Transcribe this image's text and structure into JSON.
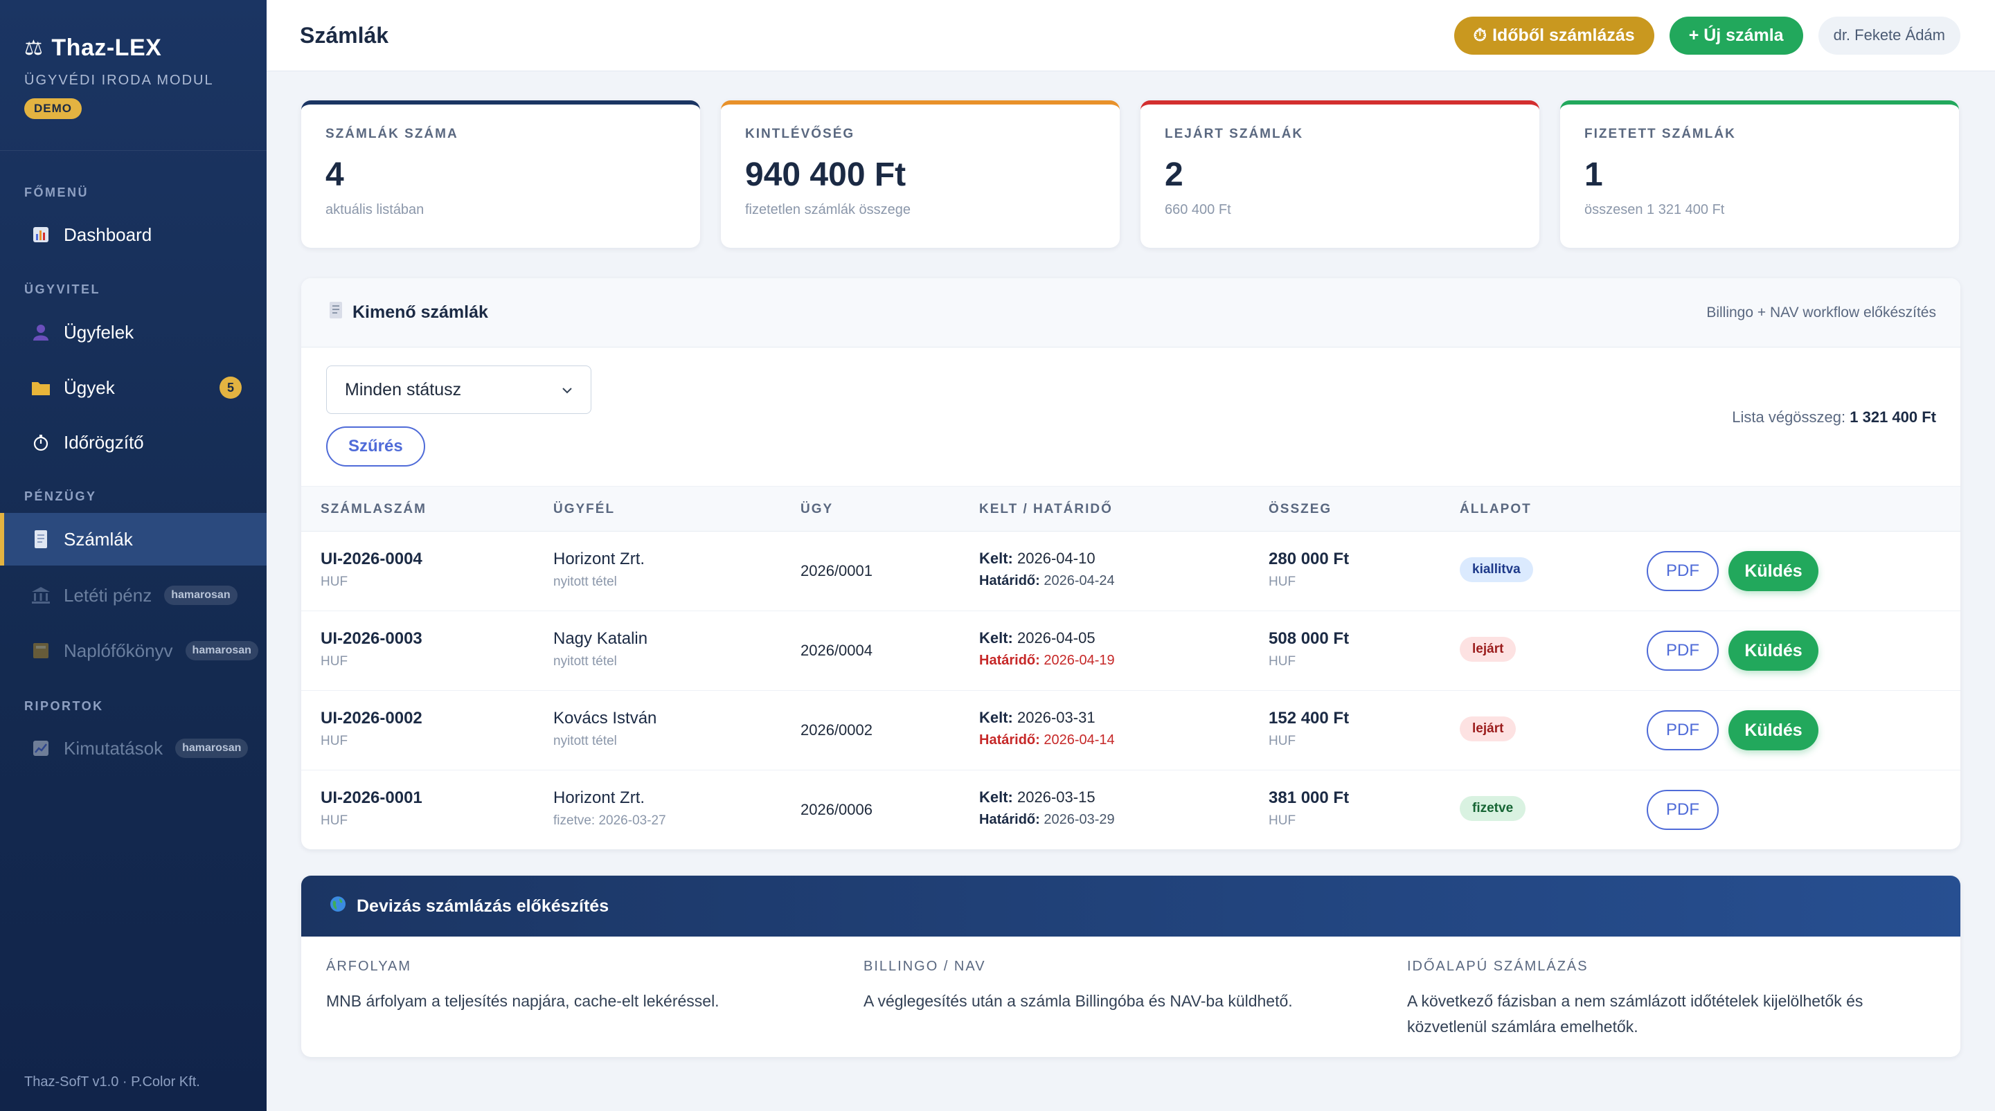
{
  "app": {
    "name": "Thaz-LEX",
    "subtitle": "ÜGYVÉDI IRODA MODUL",
    "badge": "DEMO",
    "footer": "Thaz-SofT v1.0 · P.Color Kft."
  },
  "sidebar": {
    "sections": [
      "FŐMENÜ",
      "ÜGYVITEL",
      "PÉNZÜGY",
      "RIPORTOK"
    ],
    "items": [
      {
        "label": "Dashboard",
        "icon": "bar-chart-icon"
      },
      {
        "label": "Ügyfelek",
        "icon": "person-icon"
      },
      {
        "label": "Ügyek",
        "icon": "folder-icon",
        "count": "5"
      },
      {
        "label": "Időrögzítő",
        "icon": "stopwatch-icon"
      },
      {
        "label": "Számlák",
        "icon": "invoice-icon",
        "active": true
      },
      {
        "label": "Letéti pénz",
        "icon": "bank-icon",
        "tag": "hamarosan"
      },
      {
        "label": "Naplófőkönyv",
        "icon": "ledger-icon",
        "tag": "hamarosan"
      },
      {
        "label": "Kimutatások",
        "icon": "chart-icon",
        "tag": "hamarosan"
      }
    ]
  },
  "header": {
    "title": "Számlák",
    "time_billing_label": "Időből számlázás",
    "new_invoice_label": "+ Új számla",
    "user": "dr. Fekete Ádám"
  },
  "stats": [
    {
      "label": "SZÁMLÁK SZÁMA",
      "value": "4",
      "sub": "aktuális listában",
      "color": "#1b3563"
    },
    {
      "label": "KINTLÉVŐSÉG",
      "value": "940 400 Ft",
      "sub": "fizetetlen számlák összege",
      "color": "#e8912a"
    },
    {
      "label": "LEJÁRT SZÁMLÁK",
      "value": "2",
      "sub": "660 400 Ft",
      "color": "#d32f2f"
    },
    {
      "label": "FIZETETT SZÁMLÁK",
      "value": "1",
      "sub": "összesen 1 321 400 Ft",
      "color": "#22a85c"
    }
  ],
  "invoices_panel": {
    "title": "Kimenő számlák",
    "note": "Billingo + NAV workflow előkészítés",
    "filter_value": "Minden státusz",
    "filter_button": "Szűrés",
    "total_label": "Lista végösszeg:",
    "total_value": "1 321 400 Ft",
    "columns": [
      "SZÁMLASZÁM",
      "ÜGYFÉL",
      "ÜGY",
      "KELT / HATÁRIDŐ",
      "ÖSSZEG",
      "ÁLLAPOT"
    ],
    "issued_label": "Kelt:",
    "due_label": "Határidő:",
    "pdf_label": "PDF",
    "send_label": "Küldés",
    "rows": [
      {
        "number": "UI-2026-0004",
        "currency": "HUF",
        "client": "Horizont Zrt.",
        "client_note": "nyitott tétel",
        "case": "2026/0001",
        "issued": "2026-04-10",
        "due": "2026-04-24",
        "amount": "280 000 Ft",
        "amount_currency": "HUF",
        "status": "kiallitva"
      },
      {
        "number": "UI-2026-0003",
        "currency": "HUF",
        "client": "Nagy Katalin",
        "client_note": "nyitott tétel",
        "case": "2026/0004",
        "issued": "2026-04-05",
        "due": "2026-04-19",
        "amount": "508 000 Ft",
        "amount_currency": "HUF",
        "status": "lejárt"
      },
      {
        "number": "UI-2026-0002",
        "currency": "HUF",
        "client": "Kovács István",
        "client_note": "nyitott tétel",
        "case": "2026/0002",
        "issued": "2026-03-31",
        "due": "2026-04-14",
        "amount": "152 400 Ft",
        "amount_currency": "HUF",
        "status": "lejárt"
      },
      {
        "number": "UI-2026-0001",
        "currency": "HUF",
        "client": "Horizont Zrt.",
        "client_note": "fizetve: 2026-03-27",
        "case": "2026/0006",
        "issued": "2026-03-15",
        "due": "2026-03-29",
        "amount": "381 000 Ft",
        "amount_currency": "HUF",
        "status": "fizetve"
      }
    ]
  },
  "currency_panel": {
    "title": "Devizás számlázás előkészítés",
    "columns": [
      {
        "label": "ÁRFOLYAM",
        "text": "MNB árfolyam a teljesítés napjára, cache-elt lekéréssel."
      },
      {
        "label": "BILLINGO / NAV",
        "text": "A véglegesítés után a számla Billingóba és NAV-ba küldhető."
      },
      {
        "label": "IDŐALAPÚ SZÁMLÁZÁS",
        "text": "A következő fázisban a nem számlázott időtételek kijelölhetők és közvetlenül számlára emelhetők."
      }
    ]
  },
  "colors": {
    "sidebar": "#1b3563",
    "accent_gold": "#e3b341",
    "primary_green": "#22a85c",
    "link_blue": "#4f6bd8",
    "danger": "#c62828"
  }
}
